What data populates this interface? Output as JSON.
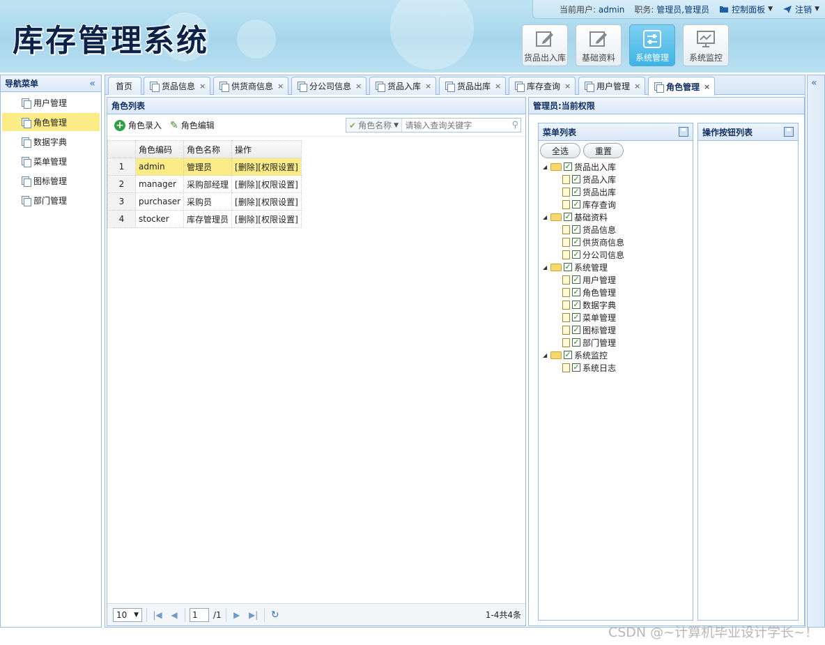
{
  "app": {
    "title": "库存管理系统"
  },
  "topbar": {
    "user_label": "当前用户:",
    "user_value": "admin",
    "role_label": "职务:",
    "role_value": "管理员,管理员",
    "control_panel": "控制面板",
    "logout": "注销"
  },
  "modules": [
    {
      "label": "货品出入库",
      "icon": "edit-icon"
    },
    {
      "label": "基础资料",
      "icon": "edit-icon"
    },
    {
      "label": "系统管理",
      "icon": "settings-sliders-icon",
      "active": true
    },
    {
      "label": "系统监控",
      "icon": "monitor-icon"
    }
  ],
  "nav": {
    "title": "导航菜单",
    "items": [
      "用户管理",
      "角色管理",
      "数据字典",
      "菜单管理",
      "图标管理",
      "部门管理"
    ],
    "selected": "角色管理"
  },
  "tabs": [
    "首页",
    "货品信息",
    "供货商信息",
    "分公司信息",
    "货品入库",
    "货品出库",
    "库存查询",
    "用户管理",
    "角色管理"
  ],
  "active_tab": "角色管理",
  "role_list": {
    "title": "角色列表",
    "add_label": "角色录入",
    "edit_label": "角色编辑",
    "search_field": "角色名称",
    "search_placeholder": "请输入查询关键字",
    "columns": [
      "角色编码",
      "角色名称",
      "操作"
    ],
    "rows": [
      {
        "n": "1",
        "code": "admin",
        "name": "管理员",
        "op": "[删除][权限设置]"
      },
      {
        "n": "2",
        "code": "manager",
        "name": "采购部经理",
        "op": "[删除][权限设置]"
      },
      {
        "n": "3",
        "code": "purchaser",
        "name": "采购员",
        "op": "[删除][权限设置]"
      },
      {
        "n": "4",
        "code": "stocker",
        "name": "库存管理员",
        "op": "[删除][权限设置]"
      }
    ],
    "pager": {
      "page_size": "10",
      "page": "1",
      "total_pages": "/1",
      "info": "1-4共4条"
    }
  },
  "permissions": {
    "title": "管理员:当前权限",
    "menu_list_title": "菜单列表",
    "button_list_title": "操作按钮列表",
    "select_all": "全选",
    "reset": "重置",
    "tree": [
      {
        "label": "货品出入库",
        "children": [
          "货品入库",
          "货品出库",
          "库存查询"
        ]
      },
      {
        "label": "基础资料",
        "children": [
          "货品信息",
          "供货商信息",
          "分公司信息"
        ]
      },
      {
        "label": "系统管理",
        "children": [
          "用户管理",
          "角色管理",
          "数据字典",
          "菜单管理",
          "图标管理",
          "部门管理"
        ]
      },
      {
        "label": "系统监控",
        "children": [
          "系统日志"
        ]
      }
    ]
  },
  "watermark": "CSDN @~计算机毕业设计学长~！",
  "colors": {
    "selected": "#fbec88",
    "border": "#99bbe8",
    "active_module": "#3eb3e6"
  }
}
